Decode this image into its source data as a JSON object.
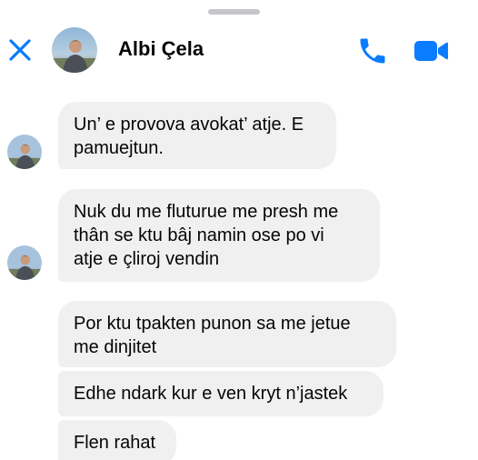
{
  "header": {
    "contact_name": "Albi Çela",
    "close_icon": "close-icon",
    "call_icon": "phone-icon",
    "video_icon": "video-camera-icon",
    "accent_color": "#0a7cff"
  },
  "messages": [
    {
      "text": "Un’ e provova avokat’ atje. E\npamuejtun."
    },
    {
      "text": "Nuk du me fluturue me presh me\nthân se ktu bâj namin ose po vi\natje e çliroj vendin"
    },
    {
      "text": "Por ktu tpakten punon sa me jetue\nme dinjitet"
    },
    {
      "text": "Edhe ndark kur e ven kryt n’jastek"
    },
    {
      "text": "Flen rahat"
    }
  ],
  "colors": {
    "bubble_bg": "#f0f0f0",
    "text": "#050505",
    "background": "#ffffff"
  }
}
